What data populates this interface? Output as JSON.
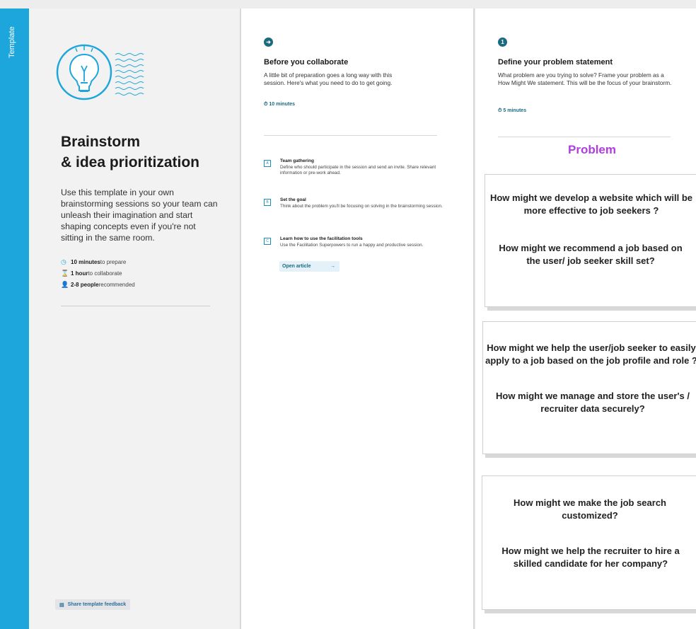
{
  "sidebar": {
    "label": "Template"
  },
  "intro": {
    "title_line1": "Brainstorm",
    "title_line2": "& idea prioritization",
    "description": "Use this template in your own brainstorming sessions so your team can unleash their imagination and start shaping concepts even if you're not sitting in the same room.",
    "meta": [
      {
        "icon": "clock-icon",
        "bold": "10 minutes",
        "rest": " to prepare"
      },
      {
        "icon": "hourglass-icon",
        "bold": "1 hour",
        "rest": " to collaborate"
      },
      {
        "icon": "person-icon",
        "bold": "2-8 people",
        "rest": " recommended"
      }
    ],
    "feedback_label": "Share template feedback"
  },
  "prep": {
    "heading": "Before you collaborate",
    "description": "A little bit of preparation goes a long way with this session. Here's what you need to do to get going.",
    "time": "10 minutes",
    "steps": [
      {
        "letter": "A",
        "title": "Team gathering",
        "text": "Define who should participate in the session and send an invite. Share relevant information or pre-work ahead."
      },
      {
        "letter": "B",
        "title": "Set the goal",
        "text": "Think about the problem you'll be focusing on solving in the brainstorming session."
      },
      {
        "letter": "C",
        "title": "Learn how to use the facilitation tools",
        "text": "Use the Facilitation Superpowers to run a happy and productive session."
      }
    ],
    "open_article": "Open article"
  },
  "define": {
    "step_number": "1",
    "heading": "Define your problem statement",
    "description": "What problem are you trying to solve? Frame your problem as a How Might We statement. This will be the focus of your brainstorm.",
    "time": "5 minutes",
    "section_title": "Problem",
    "cards": [
      {
        "q1": "How might we develop a website which will be more effective to job seekers ?",
        "q2": "How might we recommend a job based on the user/ job seeker skill set?"
      },
      {
        "q1": "How might we help the user/job seeker to easily apply to a job based on the job profile and role ?",
        "q2": "How might we manage and store the user's / recruiter data securely?"
      },
      {
        "q1": "How might we make the job search customized?",
        "q2": "How might we help the recruiter to hire a skilled candidate for her company?"
      }
    ]
  },
  "colors": {
    "accent": "#1ca6dc",
    "problem": "#b03ede",
    "step_circle": "#1a6a80"
  }
}
